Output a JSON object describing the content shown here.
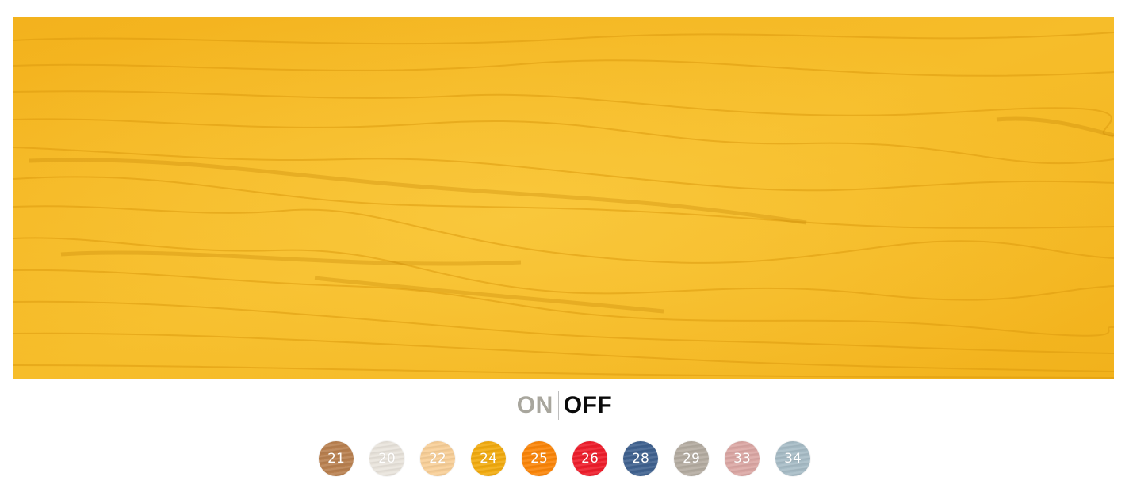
{
  "preview": {
    "description_icon": "wood-grain-preview",
    "base_color": "#f4b81f"
  },
  "toggle": {
    "on_label": "ON",
    "off_label": "OFF",
    "selected": "OFF"
  },
  "swatches": [
    {
      "label": "21",
      "color": "#b9804f"
    },
    {
      "label": "20",
      "color": "#e9e4dc"
    },
    {
      "label": "22",
      "color": "#f8cf98"
    },
    {
      "label": "24",
      "color": "#f2ab0f"
    },
    {
      "label": "25",
      "color": "#fb8508"
    },
    {
      "label": "26",
      "color": "#ee1d2b"
    },
    {
      "label": "28",
      "color": "#3f618f"
    },
    {
      "label": "29",
      "color": "#b4aca1"
    },
    {
      "label": "33",
      "color": "#dba7a4"
    },
    {
      "label": "34",
      "color": "#a7bcc6"
    }
  ]
}
